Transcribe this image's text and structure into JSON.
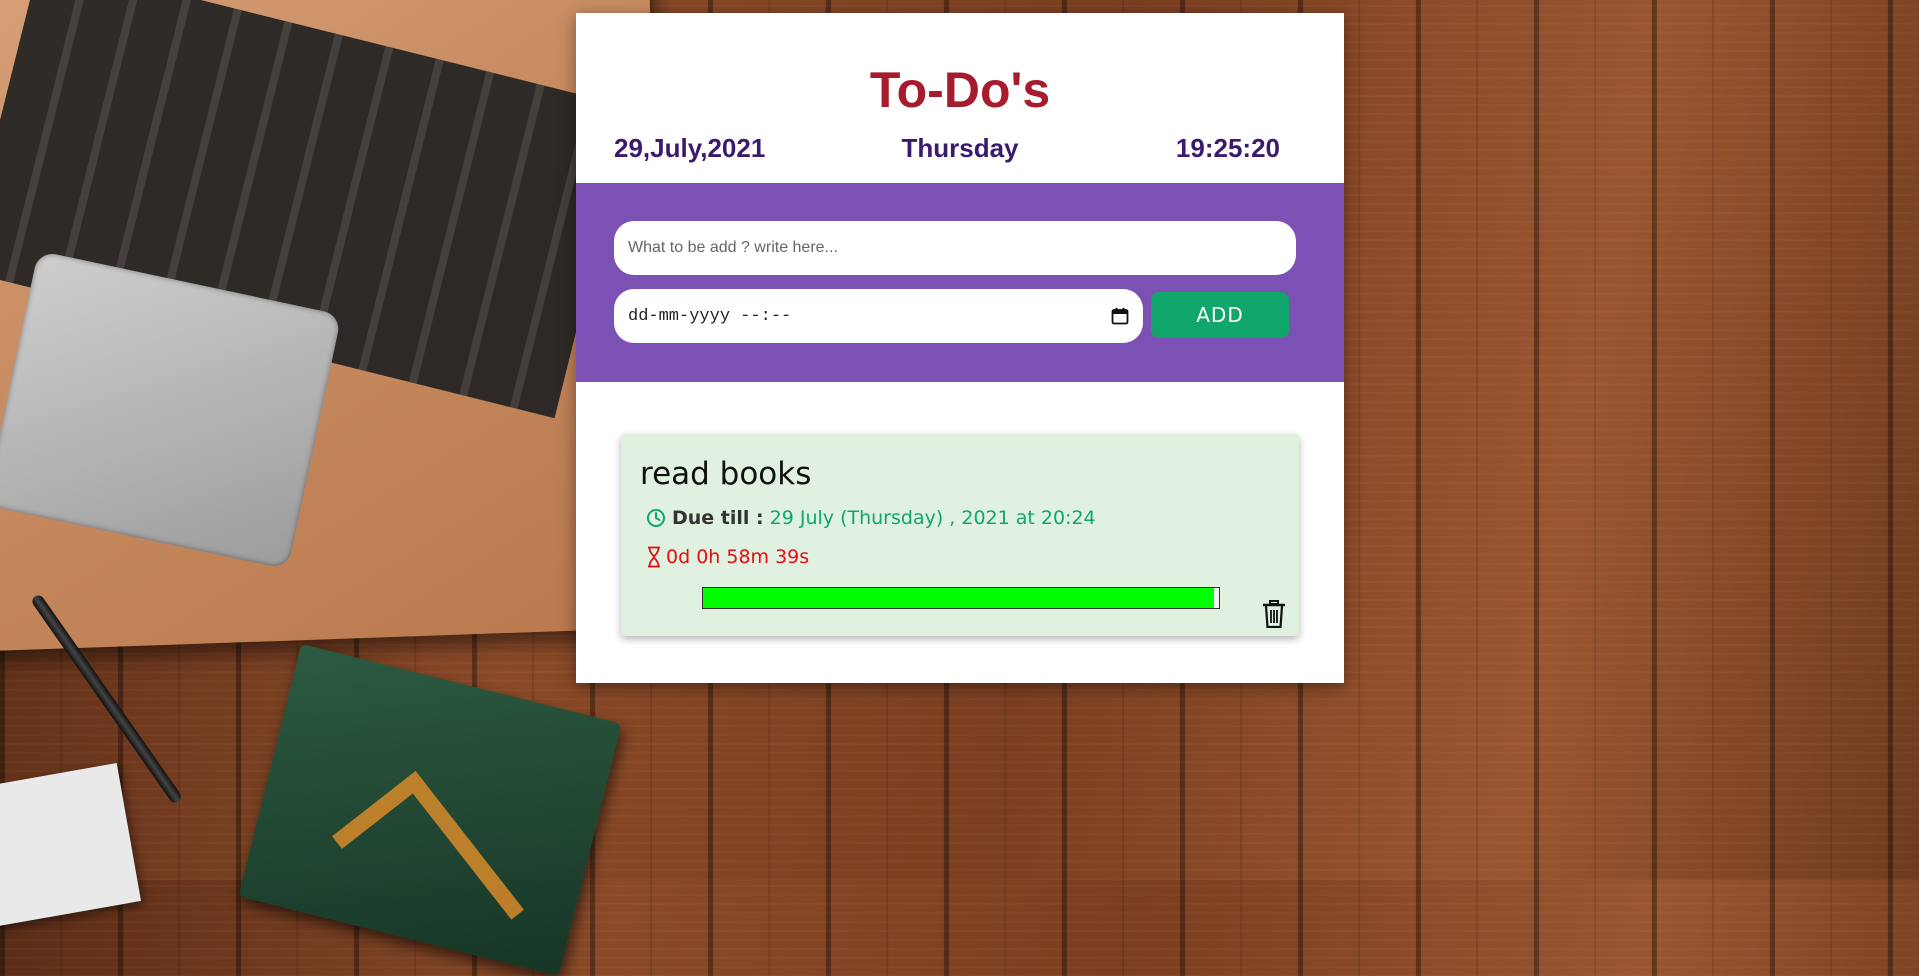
{
  "app": {
    "title": "To-Do's",
    "date": "29,July,2021",
    "day": "Thursday",
    "time": "19:25:20"
  },
  "form": {
    "task_placeholder": "What to be add ? write here...",
    "datetime_placeholder": "dd-mm-yyyy --:--",
    "add_label": "ADD"
  },
  "todos": [
    {
      "title": "read books",
      "due_label": "Due till :",
      "due_value": "29 July (Thursday) , 2021 at 20:24",
      "remaining": "0d 0h 58m 39s",
      "progress_fraction": 0.99
    }
  ],
  "colors": {
    "title": "#a61c2c",
    "date_text": "#3a1a6e",
    "panel": "#7b52b3",
    "add_button": "#10a66b",
    "card_bg": "#e0f1e1",
    "due_value": "#10a66b",
    "remaining": "#e01010",
    "progress": "#00ff00"
  },
  "icons": {
    "due": "clock-icon",
    "remaining": "hourglass-icon",
    "delete": "trash-icon",
    "date_picker": "calendar-icon"
  }
}
